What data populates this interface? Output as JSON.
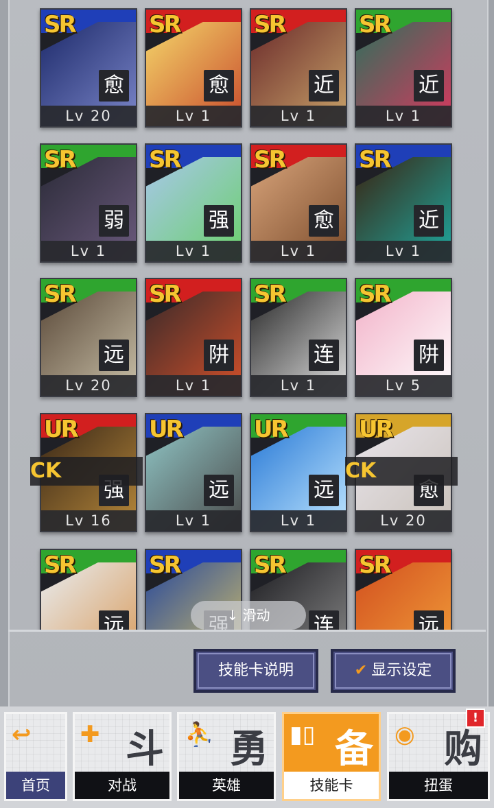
{
  "cards": [
    {
      "rarity": "SR",
      "type": "愈",
      "level": "Lv 20",
      "band": "#1f3fb8",
      "art": [
        "#1d2a6a",
        "#7b86c9"
      ],
      "locked": false
    },
    {
      "rarity": "SR",
      "type": "愈",
      "level": "Lv 1",
      "band": "#d21f1f",
      "art": [
        "#f4d66a",
        "#c84b2c"
      ],
      "locked": false
    },
    {
      "rarity": "SR",
      "type": "近",
      "level": "Lv 1",
      "band": "#d21f1f",
      "art": [
        "#6b2b2b",
        "#c9a46a"
      ],
      "locked": false
    },
    {
      "rarity": "SR",
      "type": "近",
      "level": "Lv 1",
      "band": "#2fa52f",
      "art": [
        "#2f6f5b",
        "#d8385e"
      ],
      "locked": false
    },
    {
      "rarity": "SR",
      "type": "弱",
      "level": "Lv 1",
      "band": "#2fa52f",
      "art": [
        "#2b2b38",
        "#6b5a7d"
      ],
      "locked": false
    },
    {
      "rarity": "SR",
      "type": "强",
      "level": "Lv 1",
      "band": "#1f3fb8",
      "art": [
        "#a8c7ea",
        "#6ad06a"
      ],
      "locked": false
    },
    {
      "rarity": "SR",
      "type": "愈",
      "level": "Lv 1",
      "band": "#d21f1f",
      "art": [
        "#d7a37a",
        "#7a4b2b"
      ],
      "locked": false
    },
    {
      "rarity": "SR",
      "type": "近",
      "level": "Lv 1",
      "band": "#1f3fb8",
      "art": [
        "#3a2412",
        "#1ea89f"
      ],
      "locked": false
    },
    {
      "rarity": "SR",
      "type": "远",
      "level": "Lv 20",
      "band": "#2fa52f",
      "art": [
        "#5b4a3a",
        "#c9c0a8"
      ],
      "locked": false
    },
    {
      "rarity": "SR",
      "type": "阱",
      "level": "Lv 1",
      "band": "#d21f1f",
      "art": [
        "#3a2a2a",
        "#d2502a"
      ],
      "locked": false
    },
    {
      "rarity": "SR",
      "type": "连",
      "level": "Lv 1",
      "band": "#2fa52f",
      "art": [
        "#2b2b2b",
        "#e0e0e0"
      ],
      "locked": false
    },
    {
      "rarity": "SR",
      "type": "阱",
      "level": "Lv 5",
      "band": "#2fa52f",
      "art": [
        "#f2b3c9",
        "#ffffff"
      ],
      "locked": false
    },
    {
      "rarity": "UR",
      "type": "强",
      "level": "Lv 16",
      "band": "#d21f1f",
      "art": [
        "#3a2818",
        "#b8893a"
      ],
      "locked": true,
      "lock_text": "CK"
    },
    {
      "rarity": "UR",
      "type": "远",
      "level": "Lv 1",
      "band": "#1f3fb8",
      "art": [
        "#8fc4c4",
        "#4a4a4a"
      ],
      "locked": false
    },
    {
      "rarity": "UR",
      "type": "远",
      "level": "Lv 1",
      "band": "#2fa52f",
      "art": [
        "#2a7ad6",
        "#bfe6ff"
      ],
      "locked": false
    },
    {
      "rarity": "UR",
      "type": "愈",
      "level": "Lv 20",
      "band": "#d6a52a",
      "art": [
        "#e8e4ea",
        "#c8c0b8"
      ],
      "locked": true,
      "lock_text": "CK"
    },
    {
      "rarity": "SR",
      "type": "远",
      "level": "",
      "band": "#2fa52f",
      "art": [
        "#e8ecef",
        "#d89a5a"
      ],
      "locked": false
    },
    {
      "rarity": "SR",
      "type": "强",
      "level": "",
      "band": "#1f3fb8",
      "art": [
        "#2a4a9a",
        "#d2c06a"
      ],
      "locked": false
    },
    {
      "rarity": "SR",
      "type": "连",
      "level": "",
      "band": "#2fa52f",
      "art": [
        "#1e1e22",
        "#8a8a8a"
      ],
      "locked": false
    },
    {
      "rarity": "SR",
      "type": "远",
      "level": "",
      "band": "#d21f1f",
      "art": [
        "#d2501f",
        "#f2a03a"
      ],
      "locked": false
    }
  ],
  "scroll_hint": "↓ 滑动",
  "buttons": {
    "skill_card_info": "技能卡说明",
    "display_settings": "显示设定"
  },
  "nav": [
    {
      "label": "首页",
      "icon": "back-arrow-icon",
      "glyph": "↩",
      "big": ""
    },
    {
      "label": "对战",
      "icon": "gamepad-icon",
      "glyph": "✚",
      "big": "斗"
    },
    {
      "label": "英雄",
      "icon": "hero-icon",
      "glyph": "⛹",
      "big": "勇"
    },
    {
      "label": "技能卡",
      "icon": "cards-icon",
      "glyph": "▮▯",
      "big": "备"
    },
    {
      "label": "扭蛋",
      "icon": "capsule-icon",
      "glyph": "◉",
      "big": "购"
    }
  ],
  "active_tab": 3,
  "notification": "!"
}
